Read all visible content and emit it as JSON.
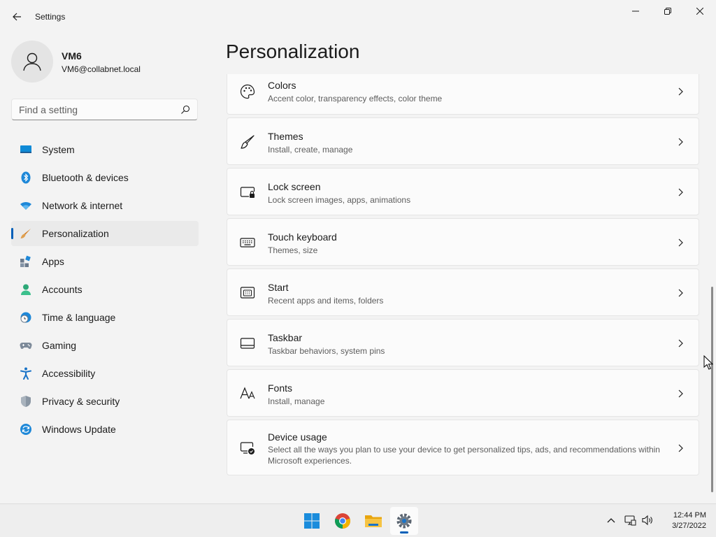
{
  "window": {
    "title": "Settings"
  },
  "profile": {
    "name": "VM6",
    "email": "VM6@collabnet.local"
  },
  "search": {
    "placeholder": "Find a setting"
  },
  "nav": {
    "items": [
      {
        "label": "System",
        "icon": "monitor-icon"
      },
      {
        "label": "Bluetooth & devices",
        "icon": "bluetooth-icon"
      },
      {
        "label": "Network & internet",
        "icon": "wifi-icon"
      },
      {
        "label": "Personalization",
        "icon": "brush-icon",
        "active": true
      },
      {
        "label": "Apps",
        "icon": "apps-icon"
      },
      {
        "label": "Accounts",
        "icon": "person-icon"
      },
      {
        "label": "Time & language",
        "icon": "globe-clock-icon"
      },
      {
        "label": "Gaming",
        "icon": "gamepad-icon"
      },
      {
        "label": "Accessibility",
        "icon": "accessibility-icon"
      },
      {
        "label": "Privacy & security",
        "icon": "shield-icon"
      },
      {
        "label": "Windows Update",
        "icon": "update-icon"
      }
    ]
  },
  "page": {
    "title": "Personalization"
  },
  "cards": [
    {
      "title": "Colors",
      "subtitle": "Accent color, transparency effects, color theme",
      "icon": "palette-icon"
    },
    {
      "title": "Themes",
      "subtitle": "Install, create, manage",
      "icon": "brush-icon"
    },
    {
      "title": "Lock screen",
      "subtitle": "Lock screen images, apps, animations",
      "icon": "lock-screen-icon"
    },
    {
      "title": "Touch keyboard",
      "subtitle": "Themes, size",
      "icon": "keyboard-icon"
    },
    {
      "title": "Start",
      "subtitle": "Recent apps and items, folders",
      "icon": "start-icon"
    },
    {
      "title": "Taskbar",
      "subtitle": "Taskbar behaviors, system pins",
      "icon": "taskbar-icon"
    },
    {
      "title": "Fonts",
      "subtitle": "Install, manage",
      "icon": "fonts-icon"
    },
    {
      "title": "Device usage",
      "subtitle": "Select all the ways you plan to use your device to get personalized tips, ads, and recommendations within Microsoft experiences.",
      "icon": "device-usage-icon"
    }
  ],
  "taskbar": {
    "apps": [
      {
        "name": "Start",
        "icon": "windows-logo-icon"
      },
      {
        "name": "Google Chrome",
        "icon": "chrome-icon"
      },
      {
        "name": "File Explorer",
        "icon": "folder-icon"
      },
      {
        "name": "Settings",
        "icon": "settings-gear-icon",
        "active": true
      }
    ],
    "clock": {
      "time": "12:44 PM",
      "date": "3/27/2022"
    }
  },
  "colors": {
    "accent": "#005fb8",
    "background": "#f3f3f3",
    "card": "#fbfbfb"
  }
}
